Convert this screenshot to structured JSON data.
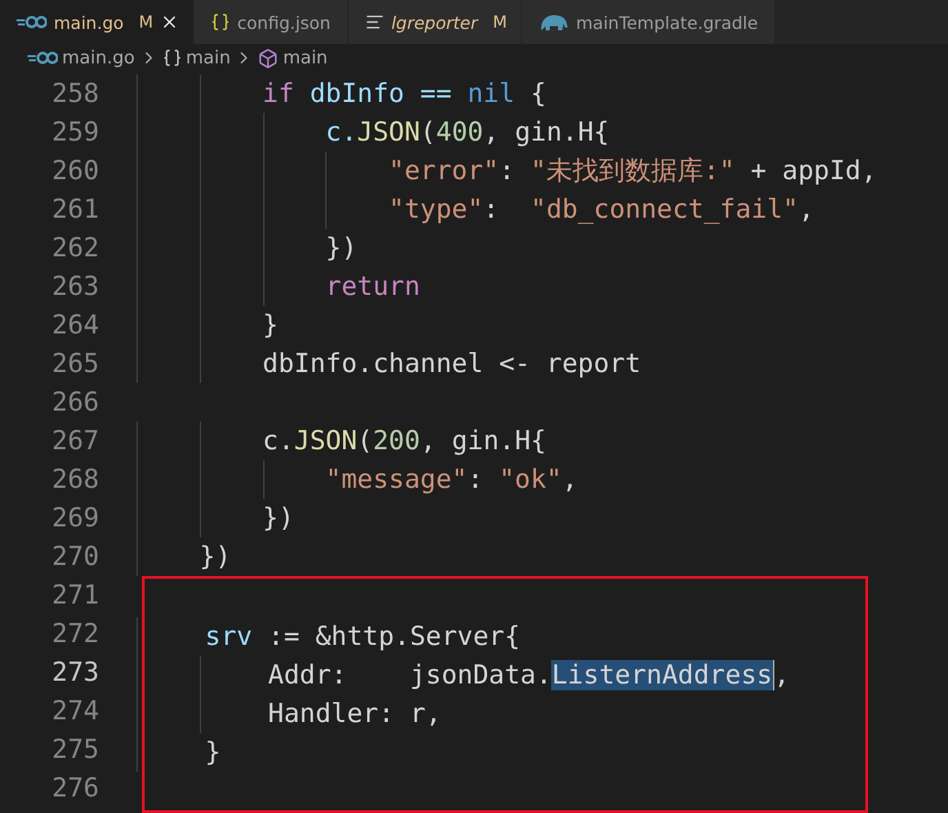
{
  "tabs": [
    {
      "label": "main.go",
      "kind": "go",
      "modified": "M",
      "selected": true,
      "italic": false
    },
    {
      "label": "config.json",
      "kind": "json",
      "selected": false,
      "italic": false
    },
    {
      "label": "lgreporter",
      "kind": "text",
      "modified": "M",
      "selected": false,
      "italic": true
    },
    {
      "label": "mainTemplate.gradle",
      "kind": "gradle",
      "selected": false,
      "italic": false
    }
  ],
  "breadcrumb": [
    {
      "label": "main.go",
      "kind": "file"
    },
    {
      "label": "main",
      "kind": "namespace"
    },
    {
      "label": "main",
      "kind": "function"
    }
  ],
  "editor": {
    "blocks": [
      {
        "boxed": false,
        "lines": [
          {
            "number": "258",
            "current": false,
            "tokens": [
              {
                "text": "        if",
                "kind": "keyword"
              },
              {
                "text": " dbInfo == ",
                "kind": "var"
              },
              {
                "text": "nil",
                "kind": "const"
              },
              {
                "text": " {",
                "kind": "plain"
              }
            ]
          },
          {
            "number": "259",
            "current": false,
            "tokens": [
              {
                "text": "            c.",
                "kind": "var"
              },
              {
                "text": "JSON",
                "kind": "func"
              },
              {
                "text": "(",
                "kind": "plain"
              },
              {
                "text": "400",
                "kind": "number"
              },
              {
                "text": ", gin.H{",
                "kind": "plain"
              }
            ]
          },
          {
            "number": "260",
            "current": false,
            "tokens": [
              {
                "text": "                \"error\"",
                "kind": "string"
              },
              {
                "text": ": ",
                "kind": "plain"
              },
              {
                "text": "\"未找到数据库:\"",
                "kind": "string"
              },
              {
                "text": " + appId,",
                "kind": "plain"
              }
            ]
          },
          {
            "number": "261",
            "current": false,
            "tokens": [
              {
                "text": "                \"type\"",
                "kind": "string"
              },
              {
                "text": ":  ",
                "kind": "plain"
              },
              {
                "text": "\"db_connect_fail\"",
                "kind": "string"
              },
              {
                "text": ",",
                "kind": "plain"
              }
            ]
          },
          {
            "number": "262",
            "current": false,
            "tokens": [
              {
                "text": "            })",
                "kind": "plain"
              }
            ]
          },
          {
            "number": "263",
            "current": false,
            "tokens": [
              {
                "text": "            return",
                "kind": "keyword"
              }
            ]
          },
          {
            "number": "264",
            "current": false,
            "tokens": [
              {
                "text": "        }",
                "kind": "plain"
              }
            ]
          },
          {
            "number": "265",
            "current": false,
            "tokens": [
              {
                "text": "        dbInfo.channel <- report",
                "kind": "plain"
              }
            ]
          },
          {
            "number": "266",
            "current": false
          },
          {
            "number": "267",
            "current": false,
            "tokens": [
              {
                "text": "        c.",
                "kind": "plain"
              },
              {
                "text": "JSON",
                "kind": "func"
              },
              {
                "text": "(",
                "kind": "plain"
              },
              {
                "text": "200",
                "kind": "number"
              },
              {
                "text": ", gin.H{",
                "kind": "plain"
              }
            ]
          },
          {
            "number": "268",
            "current": false,
            "tokens": [
              {
                "text": "            \"message\"",
                "kind": "string"
              },
              {
                "text": ": ",
                "kind": "plain"
              },
              {
                "text": "\"ok\"",
                "kind": "string"
              },
              {
                "text": ",",
                "kind": "plain"
              }
            ]
          },
          {
            "number": "269",
            "current": false,
            "tokens": [
              {
                "text": "        })",
                "kind": "plain"
              }
            ]
          },
          {
            "number": "270",
            "current": false,
            "tokens": [
              {
                "text": "    })",
                "kind": "plain"
              }
            ]
          }
        ]
      },
      {
        "boxed": true,
        "lines": [
          {
            "number": "271",
            "current": false
          },
          {
            "number": "272",
            "current": false,
            "tokens": [
              {
                "text": "    srv",
                "kind": "var"
              },
              {
                "text": " := &http.Server{",
                "kind": "plain"
              }
            ]
          },
          {
            "number": "273",
            "current": true,
            "tokens": [
              {
                "text": "        Addr:    jsonData.",
                "kind": "plain"
              },
              {
                "text": "ListernAddress",
                "kind": "selection"
              },
              {
                "text": ",",
                "kind": "plain"
              }
            ]
          },
          {
            "number": "274",
            "current": false,
            "tokens": [
              {
                "text": "        Handler: r,",
                "kind": "plain"
              }
            ]
          },
          {
            "number": "275",
            "current": false,
            "tokens": [
              {
                "text": "    }",
                "kind": "plain"
              }
            ]
          },
          {
            "number": "276",
            "current": false
          }
        ]
      }
    ]
  }
}
